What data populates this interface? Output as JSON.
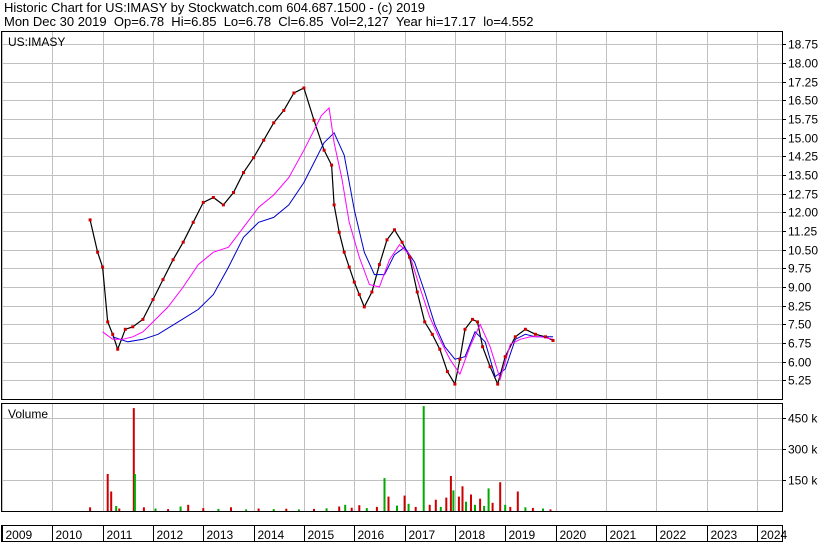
{
  "header": {
    "line1": "Historic Chart for US:IMASY by Stockwatch.com 604.687.1500 - (c) 2019",
    "line2": "Mon Dec 30 2019  Op=6.78  Hi=6.85  Lo=6.78  Cl=6.85  Vol=2,127  Year hi=17.17  lo=4.552"
  },
  "chart_data": [
    {
      "type": "line",
      "title": "US:IMASY",
      "ylim": [
        4.5,
        19.25
      ],
      "y_ticks": [
        5.25,
        6.0,
        6.75,
        7.5,
        8.25,
        9.0,
        9.75,
        10.5,
        11.25,
        12.0,
        12.75,
        13.5,
        14.25,
        15.0,
        15.75,
        16.5,
        17.25,
        18.0,
        18.75
      ],
      "y_tick_labels": [
        "5.25",
        "6.00",
        "6.75",
        "7.50",
        "8.25",
        "9.00",
        "9.75",
        "10.50",
        "11.25",
        "12.00",
        "12.75",
        "13.50",
        "14.25",
        "15.00",
        "15.75",
        "16.50",
        "17.25",
        "18.00",
        "18.75"
      ],
      "x_range": [
        2009,
        2024.5
      ],
      "x_ticks": [
        2009,
        2010,
        2011,
        2012,
        2013,
        2014,
        2015,
        2016,
        2017,
        2018,
        2019,
        2020,
        2021,
        2022,
        2023,
        2024
      ],
      "x_tick_labels": [
        "2009",
        "2010",
        "2011",
        "2012",
        "2013",
        "2014",
        "2015",
        "2016",
        "2017",
        "2018",
        "2019",
        "2020",
        "2021",
        "2022",
        "2023",
        "2024"
      ],
      "colors": {
        "price": "#000000",
        "close_dots": "#cc0000",
        "ma_short": "#ff00ff",
        "ma_long": "#0000cc",
        "grid": "#c0c0c0"
      },
      "price": {
        "x": [
          2010.75,
          2010.9,
          2011.0,
          2011.1,
          2011.2,
          2011.3,
          2011.45,
          2011.6,
          2011.8,
          2012.0,
          2012.2,
          2012.4,
          2012.6,
          2012.8,
          2013.0,
          2013.2,
          2013.4,
          2013.6,
          2013.8,
          2014.0,
          2014.2,
          2014.4,
          2014.6,
          2014.8,
          2015.0,
          2015.2,
          2015.4,
          2015.55,
          2015.6,
          2015.7,
          2015.8,
          2015.9,
          2016.0,
          2016.1,
          2016.2,
          2016.35,
          2016.5,
          2016.65,
          2016.8,
          2016.95,
          2017.1,
          2017.25,
          2017.4,
          2017.55,
          2017.7,
          2017.85,
          2018.0,
          2018.1,
          2018.2,
          2018.35,
          2018.45,
          2018.55,
          2018.7,
          2018.85,
          2019.0,
          2019.2,
          2019.4,
          2019.6,
          2019.8,
          2019.95
        ],
        "y": [
          11.7,
          10.4,
          9.8,
          7.6,
          7.1,
          6.5,
          7.3,
          7.4,
          7.7,
          8.5,
          9.3,
          10.1,
          10.8,
          11.6,
          12.4,
          12.6,
          12.3,
          12.8,
          13.6,
          14.2,
          14.9,
          15.6,
          16.1,
          16.8,
          17.0,
          15.7,
          14.5,
          13.9,
          12.3,
          11.2,
          10.4,
          9.8,
          9.2,
          8.7,
          8.2,
          8.8,
          9.9,
          10.9,
          11.3,
          10.8,
          10.2,
          8.8,
          7.6,
          7.1,
          6.5,
          5.6,
          5.1,
          6.1,
          7.3,
          7.7,
          7.6,
          6.6,
          5.8,
          5.1,
          6.2,
          7.0,
          7.3,
          7.1,
          7.0,
          6.85
        ]
      },
      "ma_short": {
        "x": [
          2011.0,
          2011.2,
          2011.4,
          2011.6,
          2011.8,
          2012.0,
          2012.3,
          2012.6,
          2012.9,
          2013.2,
          2013.5,
          2013.8,
          2014.1,
          2014.4,
          2014.7,
          2015.0,
          2015.2,
          2015.35,
          2015.5,
          2015.6,
          2015.75,
          2015.9,
          2016.1,
          2016.3,
          2016.5,
          2016.7,
          2016.9,
          2017.1,
          2017.3,
          2017.5,
          2017.7,
          2017.9,
          2018.1,
          2018.3,
          2018.5,
          2018.7,
          2018.9,
          2019.1,
          2019.3,
          2019.5,
          2019.7,
          2019.95
        ],
        "y": [
          7.2,
          6.9,
          6.9,
          7.0,
          7.2,
          7.6,
          8.2,
          9.0,
          9.9,
          10.4,
          10.6,
          11.4,
          12.2,
          12.7,
          13.4,
          14.5,
          15.3,
          15.9,
          16.2,
          14.8,
          13.4,
          11.6,
          10.2,
          9.1,
          9.0,
          10.1,
          10.7,
          10.3,
          9.0,
          7.8,
          6.9,
          6.1,
          5.5,
          6.6,
          7.5,
          6.6,
          5.3,
          6.7,
          6.9,
          7.0,
          7.0,
          6.9
        ]
      },
      "ma_long": {
        "x": [
          2011.2,
          2011.5,
          2011.8,
          2012.1,
          2012.5,
          2012.9,
          2013.2,
          2013.5,
          2013.8,
          2014.1,
          2014.4,
          2014.7,
          2015.0,
          2015.2,
          2015.4,
          2015.6,
          2015.8,
          2016.0,
          2016.2,
          2016.4,
          2016.6,
          2016.8,
          2017.0,
          2017.2,
          2017.4,
          2017.6,
          2017.8,
          2018.0,
          2018.2,
          2018.4,
          2018.6,
          2018.8,
          2019.0,
          2019.2,
          2019.4,
          2019.6,
          2019.95
        ],
        "y": [
          7.0,
          6.8,
          6.9,
          7.1,
          7.6,
          8.1,
          8.7,
          9.8,
          11.0,
          11.6,
          11.8,
          12.3,
          13.2,
          14.0,
          14.8,
          15.2,
          14.3,
          12.1,
          10.4,
          9.5,
          9.5,
          10.3,
          10.6,
          10.0,
          8.8,
          7.5,
          6.6,
          6.1,
          6.2,
          7.2,
          6.8,
          5.4,
          5.7,
          6.9,
          7.1,
          7.0,
          7.0
        ]
      }
    },
    {
      "type": "bar",
      "title": "Volume",
      "ylim": [
        0,
        520000
      ],
      "y_ticks": [
        150000,
        300000,
        450000
      ],
      "y_tick_labels": [
        "150 k",
        "300 k",
        "450 k"
      ],
      "bars": [
        {
          "x": 2010.75,
          "value": 18000,
          "color": "#cc0000"
        },
        {
          "x": 2011.1,
          "value": 180000,
          "color": "#cc0000"
        },
        {
          "x": 2011.17,
          "value": 95000,
          "color": "#cc0000"
        },
        {
          "x": 2011.27,
          "value": 25000,
          "color": "#00aa00"
        },
        {
          "x": 2011.33,
          "value": 12000,
          "color": "#cc0000"
        },
        {
          "x": 2011.62,
          "value": 500000,
          "color": "#cc0000"
        },
        {
          "x": 2011.64,
          "value": 180000,
          "color": "#00aa00"
        },
        {
          "x": 2011.82,
          "value": 18000,
          "color": "#cc0000"
        },
        {
          "x": 2012.05,
          "value": 12000,
          "color": "#00aa00"
        },
        {
          "x": 2012.3,
          "value": 9000,
          "color": "#cc0000"
        },
        {
          "x": 2012.55,
          "value": 22000,
          "color": "#00aa00"
        },
        {
          "x": 2012.7,
          "value": 30000,
          "color": "#cc0000"
        },
        {
          "x": 2013.0,
          "value": 14000,
          "color": "#cc0000"
        },
        {
          "x": 2013.3,
          "value": 10000,
          "color": "#00aa00"
        },
        {
          "x": 2013.55,
          "value": 18000,
          "color": "#cc0000"
        },
        {
          "x": 2013.85,
          "value": 8000,
          "color": "#00aa00"
        },
        {
          "x": 2014.1,
          "value": 12000,
          "color": "#cc0000"
        },
        {
          "x": 2014.4,
          "value": 9000,
          "color": "#00aa00"
        },
        {
          "x": 2014.65,
          "value": 11000,
          "color": "#cc0000"
        },
        {
          "x": 2014.9,
          "value": 8000,
          "color": "#00aa00"
        },
        {
          "x": 2015.2,
          "value": 10000,
          "color": "#cc0000"
        },
        {
          "x": 2015.45,
          "value": 13000,
          "color": "#00aa00"
        },
        {
          "x": 2015.7,
          "value": 22000,
          "color": "#cc0000"
        },
        {
          "x": 2015.82,
          "value": 30000,
          "color": "#00aa00"
        },
        {
          "x": 2015.95,
          "value": 16000,
          "color": "#cc0000"
        },
        {
          "x": 2016.1,
          "value": 28000,
          "color": "#cc0000"
        },
        {
          "x": 2016.25,
          "value": 14000,
          "color": "#00aa00"
        },
        {
          "x": 2016.45,
          "value": 20000,
          "color": "#cc0000"
        },
        {
          "x": 2016.6,
          "value": 160000,
          "color": "#00aa00"
        },
        {
          "x": 2016.68,
          "value": 70000,
          "color": "#cc0000"
        },
        {
          "x": 2016.85,
          "value": 26000,
          "color": "#00aa00"
        },
        {
          "x": 2017.0,
          "value": 75000,
          "color": "#cc0000"
        },
        {
          "x": 2017.08,
          "value": 35000,
          "color": "#00aa00"
        },
        {
          "x": 2017.22,
          "value": 20000,
          "color": "#cc0000"
        },
        {
          "x": 2017.38,
          "value": 510000,
          "color": "#00aa00"
        },
        {
          "x": 2017.5,
          "value": 30000,
          "color": "#cc0000"
        },
        {
          "x": 2017.62,
          "value": 55000,
          "color": "#cc0000"
        },
        {
          "x": 2017.72,
          "value": 20000,
          "color": "#00aa00"
        },
        {
          "x": 2017.83,
          "value": 65000,
          "color": "#cc0000"
        },
        {
          "x": 2017.92,
          "value": 170000,
          "color": "#cc0000"
        },
        {
          "x": 2017.97,
          "value": 100000,
          "color": "#00aa00"
        },
        {
          "x": 2018.08,
          "value": 70000,
          "color": "#cc0000"
        },
        {
          "x": 2018.15,
          "value": 120000,
          "color": "#cc0000"
        },
        {
          "x": 2018.22,
          "value": 45000,
          "color": "#00aa00"
        },
        {
          "x": 2018.32,
          "value": 80000,
          "color": "#cc0000"
        },
        {
          "x": 2018.4,
          "value": 30000,
          "color": "#00aa00"
        },
        {
          "x": 2018.5,
          "value": 60000,
          "color": "#cc0000"
        },
        {
          "x": 2018.58,
          "value": 25000,
          "color": "#00aa00"
        },
        {
          "x": 2018.67,
          "value": 110000,
          "color": "#00aa00"
        },
        {
          "x": 2018.75,
          "value": 40000,
          "color": "#cc0000"
        },
        {
          "x": 2018.9,
          "value": 140000,
          "color": "#cc0000"
        },
        {
          "x": 2019.0,
          "value": 30000,
          "color": "#00aa00"
        },
        {
          "x": 2019.1,
          "value": 20000,
          "color": "#cc0000"
        },
        {
          "x": 2019.25,
          "value": 95000,
          "color": "#cc0000"
        },
        {
          "x": 2019.4,
          "value": 18000,
          "color": "#00aa00"
        },
        {
          "x": 2019.55,
          "value": 15000,
          "color": "#cc0000"
        },
        {
          "x": 2019.75,
          "value": 12000,
          "color": "#00aa00"
        },
        {
          "x": 2019.9,
          "value": 8000,
          "color": "#cc0000"
        }
      ]
    }
  ]
}
